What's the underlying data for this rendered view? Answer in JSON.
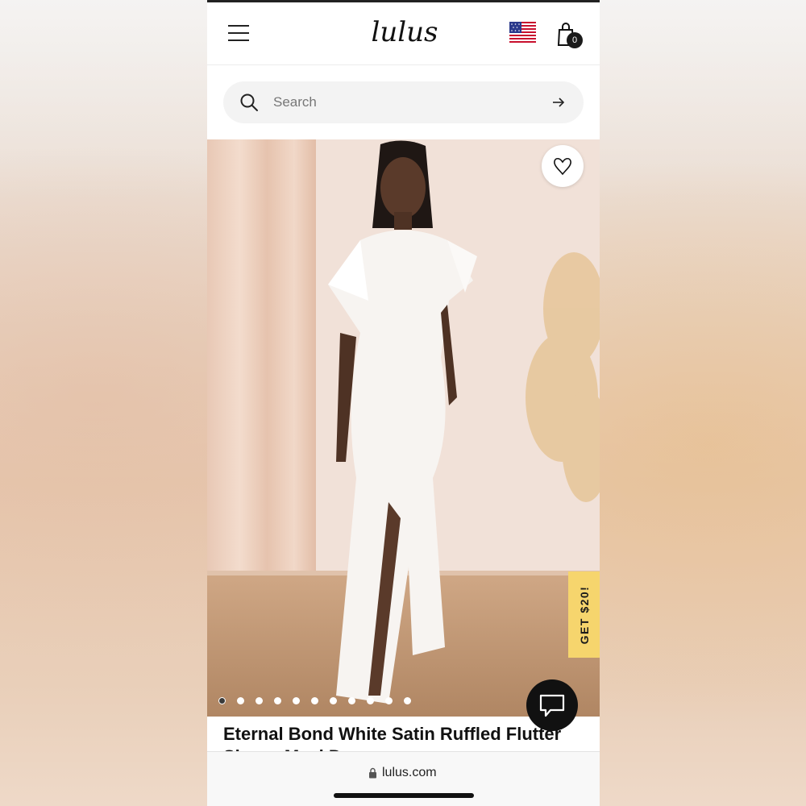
{
  "header": {
    "logo_text": "lulus",
    "cart_count": "0",
    "icons": [
      "menu-icon",
      "us-flag-icon",
      "shopping-bag-icon"
    ]
  },
  "search": {
    "placeholder": "Search"
  },
  "product": {
    "title": "Eternal Bond White Satin Ruffled Flutter Sleeve Maxi Dress",
    "image_count": 11,
    "active_image_index": 0
  },
  "promo": {
    "label": "GET $20!"
  },
  "browser": {
    "url": "lulus.com"
  },
  "colors": {
    "promo": "#f6d56d",
    "chat_button": "#111111",
    "search_bg": "#f3f3f3"
  }
}
